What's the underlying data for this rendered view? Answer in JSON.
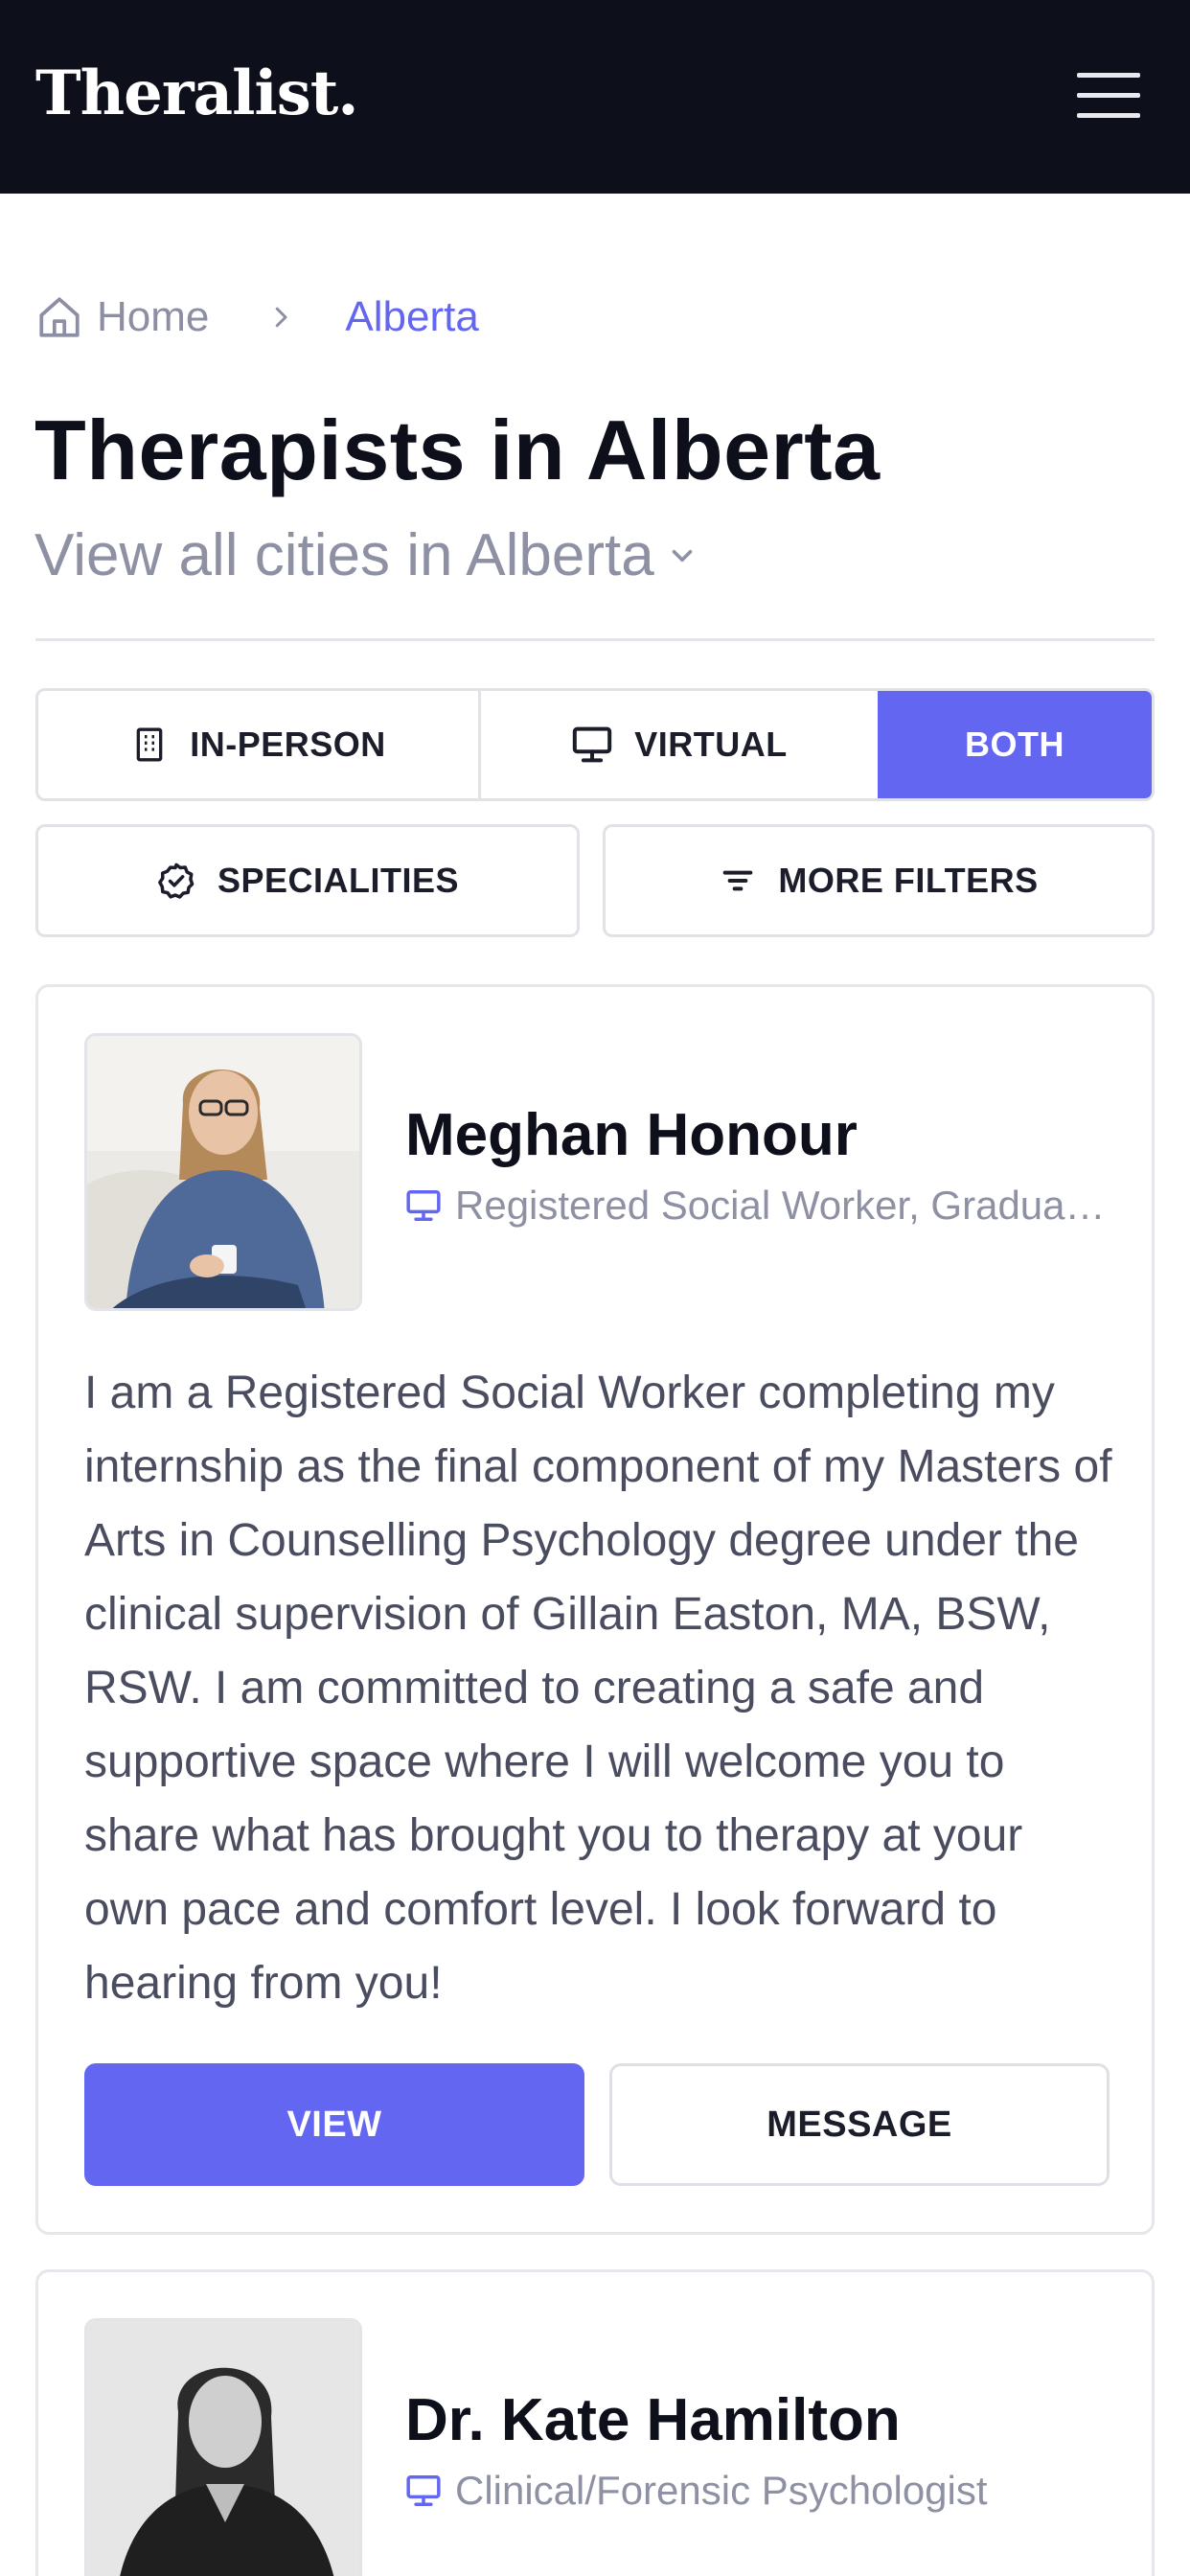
{
  "header": {
    "logo": "Theralist.",
    "menu_icon": "hamburger-menu-icon"
  },
  "breadcrumb": {
    "home_icon": "home-icon",
    "home": "Home",
    "separator_icon": "chevron-right-icon",
    "current": "Alberta"
  },
  "page": {
    "title": "Therapists in Alberta",
    "cities_link": "View all cities in Alberta"
  },
  "session_type": {
    "options": [
      {
        "label": "IN-PERSON",
        "icon": "building-icon"
      },
      {
        "label": "VIRTUAL",
        "icon": "monitor-icon"
      },
      {
        "label": "BOTH",
        "icon": ""
      }
    ],
    "selected": "BOTH"
  },
  "filters": {
    "specialities": "SPECIALITIES",
    "more_filters": "MORE FILTERS"
  },
  "therapists": [
    {
      "name": "Meghan Honour",
      "credentials": "Registered Social Worker, Graduate Student Intern",
      "bio": "I am a Registered Social Worker completing my internship as the final component of my Masters of Arts in Counselling Psychology degree under the clinical supervision of Gillain Easton, MA, BSW, RSW. I am committed to creating a safe and supportive space where I will welcome you to share what has brought you to therapy at your own pace and comfort level. I look forward to hearing from you!",
      "view_label": "VIEW",
      "message_label": "MESSAGE"
    },
    {
      "name": "Dr. Kate Hamilton",
      "credentials": "Clinical/Forensic Psychologist"
    }
  ],
  "colors": {
    "accent": "#6366f1",
    "header_bg": "#0d0f1a",
    "muted_text": "#8e91a3"
  }
}
